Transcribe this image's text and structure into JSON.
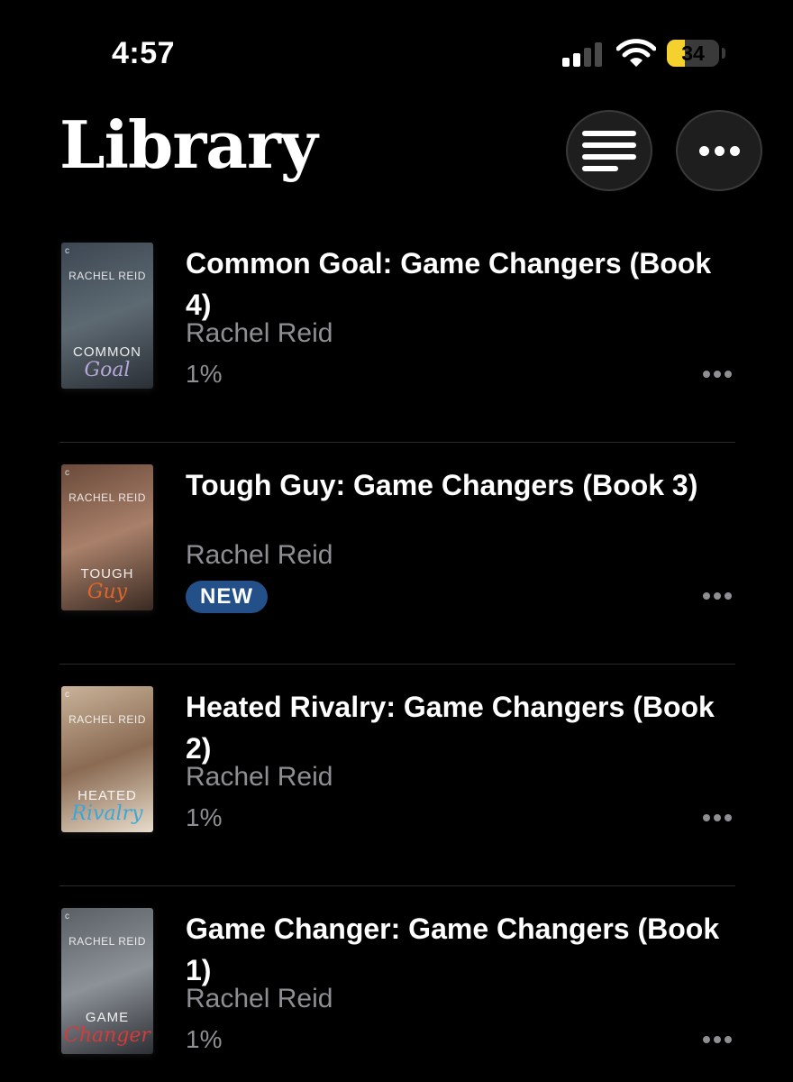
{
  "status_bar": {
    "time": "4:57",
    "battery_level": "34",
    "battery_fraction": 0.34,
    "battery_color": "#f5d130",
    "signal_bars_active": 2,
    "signal_bars_total": 4
  },
  "header": {
    "title": "Library",
    "sort_icon": "list-sort-icon",
    "more_icon": "ellipsis-icon"
  },
  "books": [
    {
      "title": "Common Goal: Game Changers (Book 4)",
      "author": "Rachel Reid",
      "progress": "1%",
      "badge": "",
      "cover": {
        "author": "RACHEL REID",
        "title_top": "COMMON",
        "title_script": "Goal",
        "palette": [
          "#3b4652",
          "#5e6a72",
          "#2a2f36"
        ],
        "script_color": "#b7a6d8"
      }
    },
    {
      "title": "Tough Guy: Game Changers (Book 3)",
      "author": "Rachel Reid",
      "progress": "",
      "badge": "NEW",
      "cover": {
        "author": "RACHEL REID",
        "title_top": "TOUGH",
        "title_script": "Guy",
        "palette": [
          "#6a4a3a",
          "#a9806a",
          "#3a2a22"
        ],
        "script_color": "#e0672c"
      }
    },
    {
      "title": "Heated Rivalry: Game Changers (Book 2)",
      "author": "Rachel Reid",
      "progress": "1%",
      "badge": "",
      "cover": {
        "author": "RACHEL REID",
        "title_top": "HEATED",
        "title_script": "Rivalry",
        "palette": [
          "#c9b39a",
          "#8a6a52",
          "#e8dccb"
        ],
        "script_color": "#3aa7d8"
      }
    },
    {
      "title": "Game Changer: Game Changers (Book 1)",
      "author": "Rachel Reid",
      "progress": "1%",
      "badge": "",
      "cover": {
        "author": "RACHEL REID",
        "title_top": "GAME",
        "title_script": "Changer",
        "palette": [
          "#5a5f66",
          "#8d9299",
          "#2c2f33"
        ],
        "script_color": "#d63a3a"
      }
    }
  ]
}
